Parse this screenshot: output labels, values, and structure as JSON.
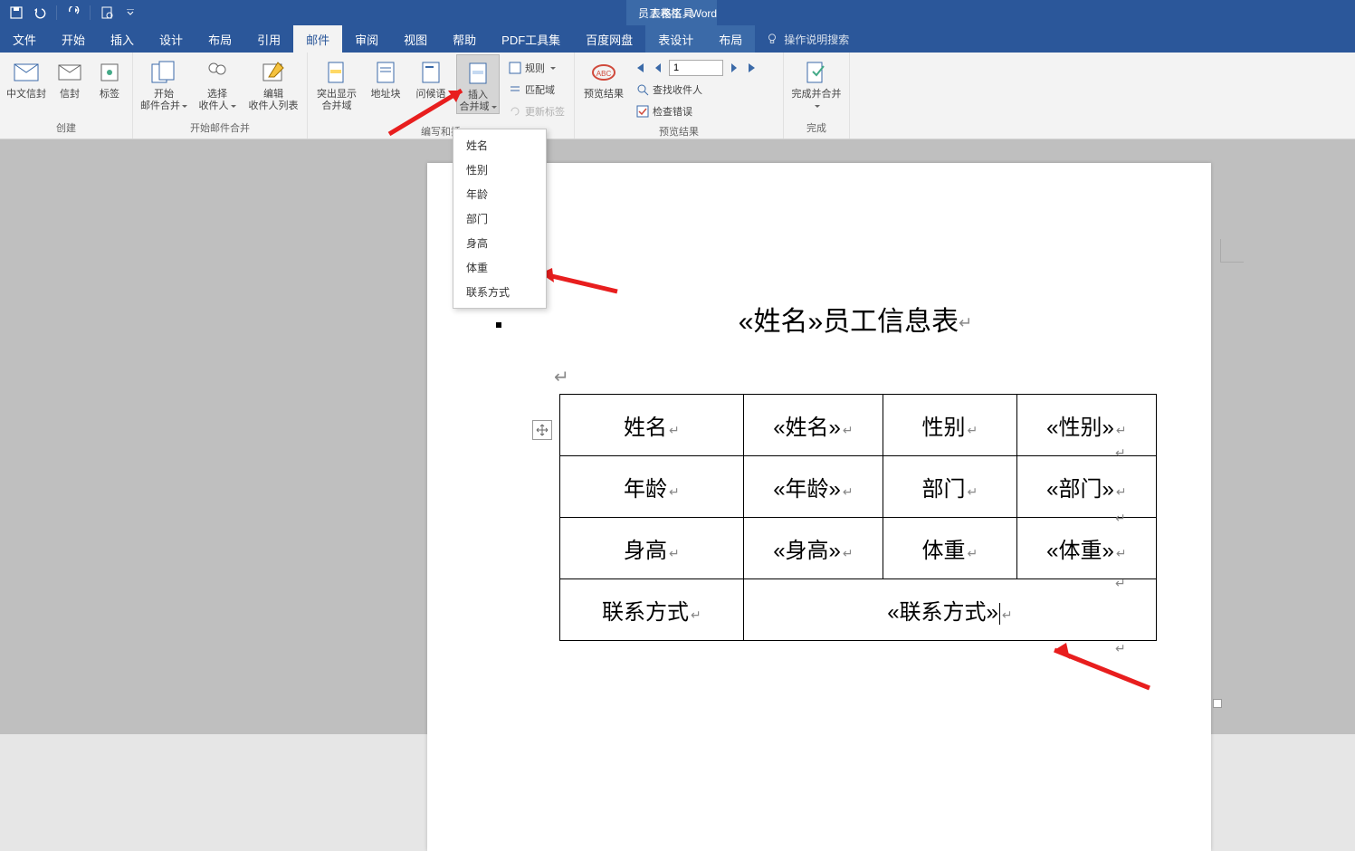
{
  "titlebar": {
    "context_tab": "表格工具",
    "doc_title": "员工表格 - Word"
  },
  "tabs": {
    "file": "文件",
    "home": "开始",
    "insert": "插入",
    "design": "设计",
    "layout": "布局",
    "references": "引用",
    "mailings": "邮件",
    "review": "审阅",
    "view": "视图",
    "help": "帮助",
    "pdf": "PDF工具集",
    "baidu": "百度网盘",
    "table_design": "表设计",
    "table_layout": "布局",
    "tellme": "操作说明搜索"
  },
  "ribbon": {
    "group_create": "创建",
    "cn_envelope": "中文信封",
    "envelope": "信封",
    "labels": "标签",
    "group_start": "开始邮件合并",
    "start_merge": "开始\n邮件合并",
    "select_recip": "选择\n收件人",
    "edit_recip": "编辑\n收件人列表",
    "group_write_hidden": "编写和插",
    "highlight": "突出显示\n合并域",
    "address_block": "地址块",
    "greeting": "问候语",
    "insert_merge": "插入\n合并域",
    "rules": "规则",
    "match": "匹配域",
    "update_labels": "更新标签",
    "group_preview": "预览结果",
    "preview": "预览结果",
    "find_recip": "查找收件人",
    "check_errors": "检查错误",
    "record_value": "1",
    "group_finish": "完成",
    "finish_merge": "完成并合并"
  },
  "dropdown": {
    "items": [
      "姓名",
      "性别",
      "年龄",
      "部门",
      "身高",
      "体重",
      "联系方式"
    ]
  },
  "doc": {
    "title_prefix": "«姓名»",
    "title_suffix": "员工信息表",
    "table": {
      "r1c1": "姓名",
      "r1c2": "«姓名»",
      "r1c3": "性别",
      "r1c4": "«性别»",
      "r2c1": "年龄",
      "r2c2": "«年龄»",
      "r2c3": "部门",
      "r2c4": "«部门»",
      "r3c1": "身高",
      "r3c2": "«身高»",
      "r3c3": "体重",
      "r3c4": "«体重»",
      "r4c1": "联系方式",
      "r4c2": "«联系方式»"
    }
  }
}
